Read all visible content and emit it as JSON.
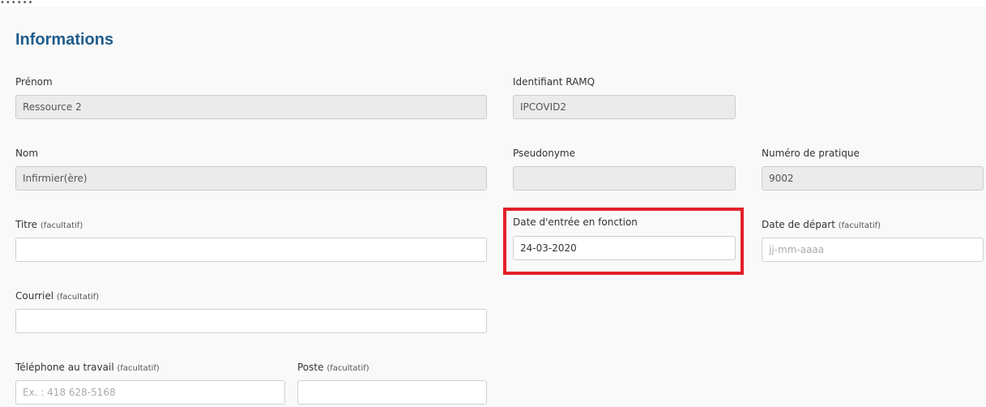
{
  "section_title": "Informations",
  "colors": {
    "accent": "#1f5c8a",
    "highlight": "#e3202a"
  },
  "fields": {
    "prenom": {
      "label": "Prénom",
      "value": "Ressource 2"
    },
    "identifiant_ramq": {
      "label": "Identifiant RAMQ",
      "value": "IPCOVID2"
    },
    "nom": {
      "label": "Nom",
      "value": "Infirmier(ère)"
    },
    "pseudonyme": {
      "label": "Pseudonyme",
      "value": ""
    },
    "numero_pratique": {
      "label": "Numéro de pratique",
      "value": "9002"
    },
    "titre": {
      "label": "Titre",
      "optional": "(facultatif)",
      "value": ""
    },
    "date_entree": {
      "label": "Date d'entrée en fonction",
      "value": "24-03-2020"
    },
    "date_depart": {
      "label": "Date de départ",
      "optional": "(facultatif)",
      "value": "",
      "placeholder": "jj-mm-aaaa"
    },
    "courriel": {
      "label": "Courriel",
      "optional": "(facultatif)",
      "value": ""
    },
    "telephone": {
      "label": "Téléphone au travail",
      "optional": "(facultatif)",
      "value": "",
      "placeholder": "Ex. : 418 628-5168"
    },
    "poste": {
      "label": "Poste",
      "optional": "(facultatif)",
      "value": ""
    }
  }
}
